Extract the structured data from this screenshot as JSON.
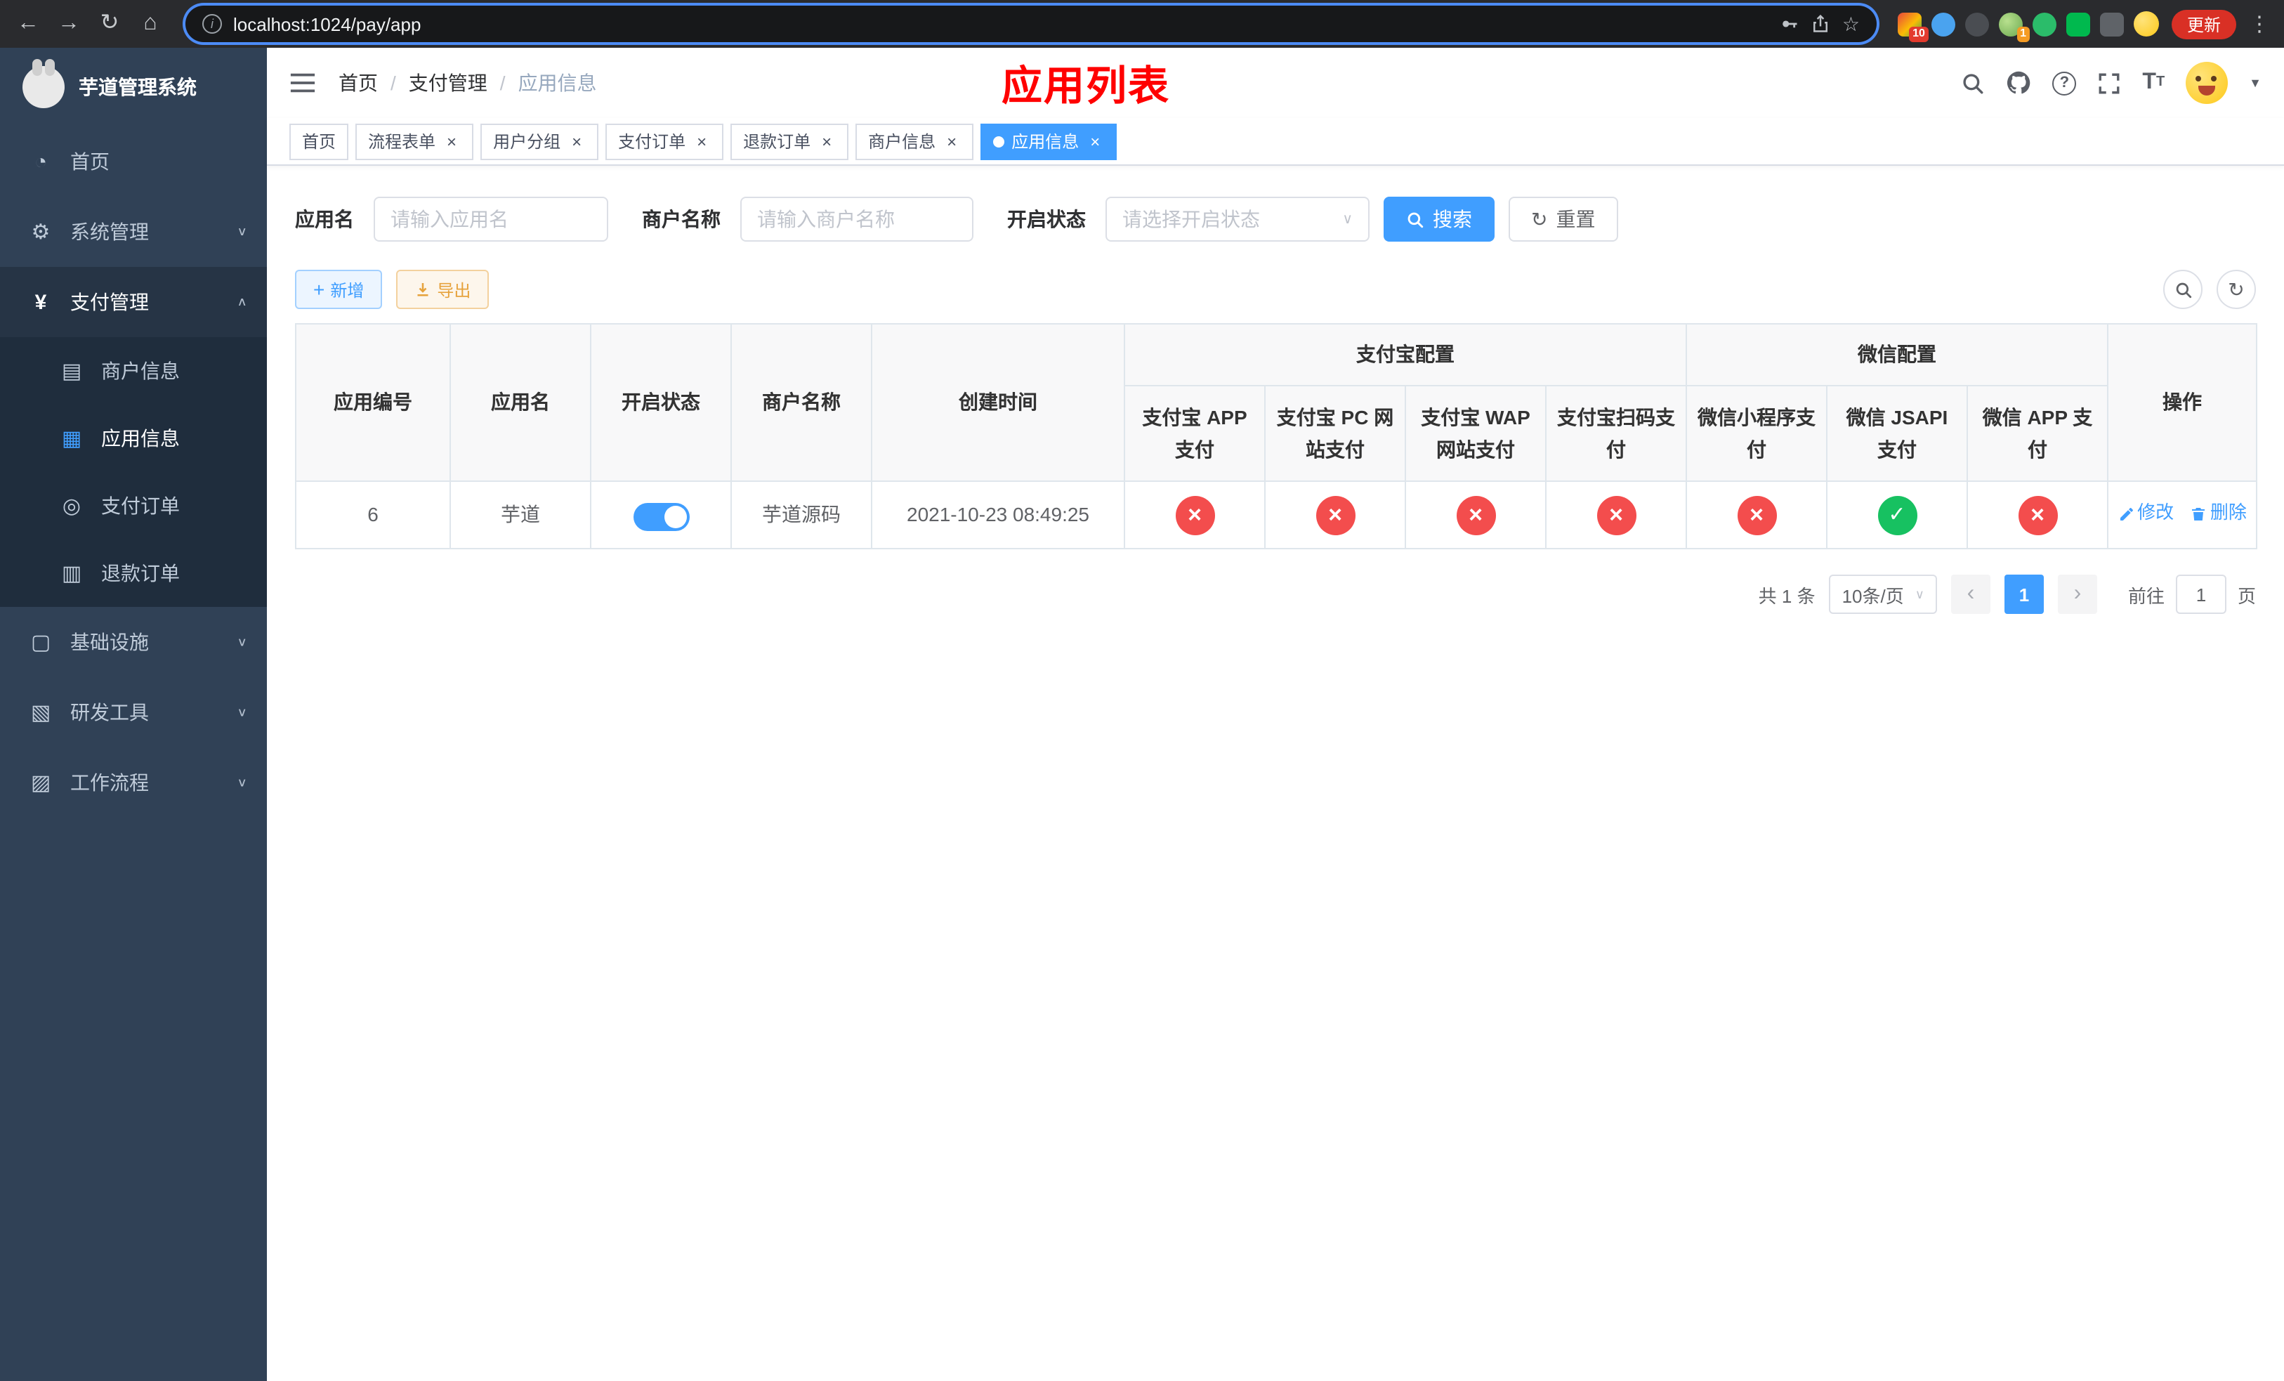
{
  "colors": {
    "primary": "#409EFF",
    "danger": "#F34D4D",
    "success": "#17C161",
    "warning": "#E6A23C",
    "sidebar_bg": "#304156",
    "title_red": "#FF0000",
    "update_red": "#D93025"
  },
  "browser": {
    "url": "localhost:1024/pay/app",
    "update_label": "更新",
    "ext_badge_red": "10",
    "ext_badge_orange": "1"
  },
  "sidebar": {
    "logo_text": "芋道管理系统",
    "items": [
      {
        "label": "首页",
        "icon": "dashboard-icon",
        "glyph": "◔"
      },
      {
        "label": "系统管理",
        "icon": "gear-icon",
        "glyph": "⚙"
      },
      {
        "label": "支付管理",
        "icon": "yen-icon",
        "glyph": "¥",
        "children": [
          {
            "label": "商户信息",
            "icon": "card-icon",
            "glyph": "▤"
          },
          {
            "label": "应用信息",
            "icon": "grid-icon",
            "glyph": "▦",
            "active": true
          },
          {
            "label": "支付订单",
            "icon": "pay-order-icon",
            "glyph": "◎"
          },
          {
            "label": "退款订单",
            "icon": "refund-order-icon",
            "glyph": "▥"
          }
        ]
      },
      {
        "label": "基础设施",
        "icon": "infra-icon",
        "glyph": "▢"
      },
      {
        "label": "研发工具",
        "icon": "devtools-icon",
        "glyph": "▧"
      },
      {
        "label": "工作流程",
        "icon": "workflow-icon",
        "glyph": "▨"
      }
    ]
  },
  "header": {
    "breadcrumb": [
      "首页",
      "支付管理",
      "应用信息"
    ],
    "page_title": "应用列表"
  },
  "tabs": [
    {
      "label": "首页"
    },
    {
      "label": "流程表单"
    },
    {
      "label": "用户分组"
    },
    {
      "label": "支付订单"
    },
    {
      "label": "退款订单"
    },
    {
      "label": "商户信息"
    },
    {
      "label": "应用信息",
      "active": true
    }
  ],
  "filters": {
    "app_name_label": "应用名",
    "app_name_placeholder": "请输入应用名",
    "merchant_label": "商户名称",
    "merchant_placeholder": "请输入商户名称",
    "status_label": "开启状态",
    "status_placeholder": "请选择开启状态",
    "search_button": "搜索",
    "reset_button": "重置"
  },
  "toolbar": {
    "add_button": "新增",
    "export_button": "导出"
  },
  "table": {
    "group_headers": {
      "alipay": "支付宝配置",
      "wechat": "微信配置"
    },
    "columns": [
      "应用编号",
      "应用名",
      "开启状态",
      "商户名称",
      "创建时间",
      "支付宝 APP 支付",
      "支付宝 PC 网站支付",
      "支付宝 WAP 网站支付",
      "支付宝扫码支付",
      "微信小程序支付",
      "微信 JSAPI 支付",
      "微信 APP 支付",
      "操作"
    ],
    "rows": [
      {
        "id": "6",
        "app_name": "芋道",
        "status_enabled": true,
        "merchant": "芋道源码",
        "created": "2021-10-23 08:49:25",
        "alipay_app": false,
        "alipay_pc": false,
        "alipay_wap": false,
        "alipay_scan": false,
        "wechat_mini": false,
        "wechat_jsapi": true,
        "wechat_app": false,
        "actions": {
          "edit": "修改",
          "delete": "删除"
        }
      }
    ]
  },
  "pagination": {
    "total_text": "共 1 条",
    "page_size": "10条/页",
    "current_page": "1",
    "goto_prefix": "前往",
    "goto_value": "1",
    "goto_suffix": "页"
  }
}
